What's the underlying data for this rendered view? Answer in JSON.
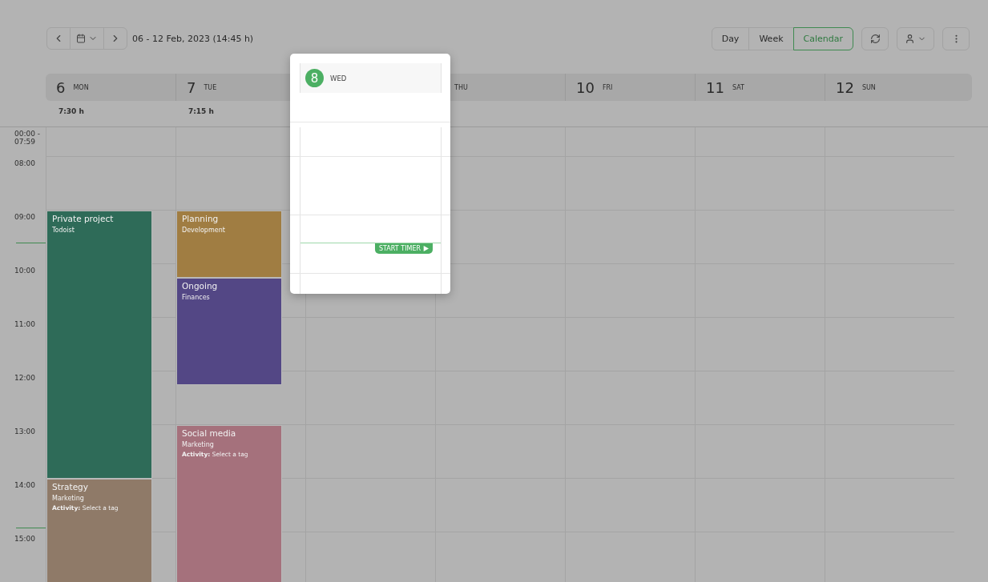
{
  "toolbar": {
    "date_range": "06 - 12 Feb, 2023 (14:45 h)",
    "views": [
      {
        "label": "Day",
        "selected": false
      },
      {
        "label": "Week",
        "selected": false
      },
      {
        "label": "Calendar",
        "selected": true
      }
    ]
  },
  "days": [
    {
      "kind": "day",
      "number": "6",
      "weekday": "MON",
      "total": "7:30 h",
      "events": [
        {
          "title": "Private project",
          "project": "Todoist",
          "color": "#2e6b58"
        },
        {
          "title": "Strategy",
          "project": "Marketing",
          "activity": "**Activity:** Select a tag",
          "color": "#8f7a68"
        }
      ]
    },
    {
      "kind": "day",
      "number": "7",
      "weekday": "TUE",
      "total": "7:15 h",
      "events": [
        {
          "title": "Planning",
          "project": "Development",
          "color": "#a07d42"
        },
        {
          "title": "Ongoing",
          "project": "Finances",
          "color": "#534785"
        },
        {
          "title": "Social media",
          "project": "Marketing",
          "activity": "**Activity:** Select a tag",
          "color": "#a5717c"
        }
      ]
    },
    {
      "kind": "covered"
    },
    {
      "kind": "day",
      "weekday": "THU"
    },
    {
      "kind": "day",
      "number": "10",
      "weekday": "FRI"
    },
    {
      "kind": "day",
      "number": "11",
      "weekday": "SAT"
    },
    {
      "kind": "day",
      "number": "12",
      "weekday": "SUN"
    }
  ],
  "hours": [
    "00:00 - 07:59",
    "08:00",
    "09:00",
    "10:00",
    "11:00",
    "12:00",
    "13:00",
    "14:00",
    "15:00"
  ],
  "popup": {
    "number": "8",
    "weekday": "WED",
    "button": "START TIMER"
  }
}
